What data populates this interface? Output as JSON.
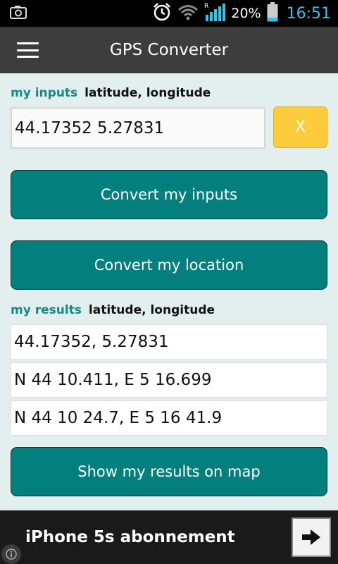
{
  "status_bar": {
    "battery": "20%",
    "time": "16:51",
    "icons": [
      "camera-icon",
      "alarm-icon",
      "wifi-icon",
      "signal-icon",
      "battery-icon"
    ]
  },
  "app_bar": {
    "title": "GPS Converter",
    "menu_icon": "hamburger-menu-icon"
  },
  "inputs": {
    "label": "my inputs",
    "format": "latitude, longitude",
    "value": "44.17352 5.27831",
    "clear_label": "X"
  },
  "actions": {
    "convert_inputs": "Convert my inputs",
    "convert_location": "Convert my location",
    "show_map": "Show my results on map"
  },
  "results": {
    "label": "my results",
    "format": "latitude, longitude",
    "rows": [
      "44.17352, 5.27831",
      "N 44 10.411, E 5 16.699",
      "N 44 10 24.7, E 5 16 41.9"
    ]
  },
  "ad": {
    "text": "iPhone 5s abonnement",
    "arrow_icon": "arrow-right-icon",
    "info_icon": "info-icon"
  },
  "colors": {
    "teal": "#037f7d",
    "yellow": "#fdcc3c",
    "background": "#e3eeee",
    "clock": "#37c3e8"
  }
}
